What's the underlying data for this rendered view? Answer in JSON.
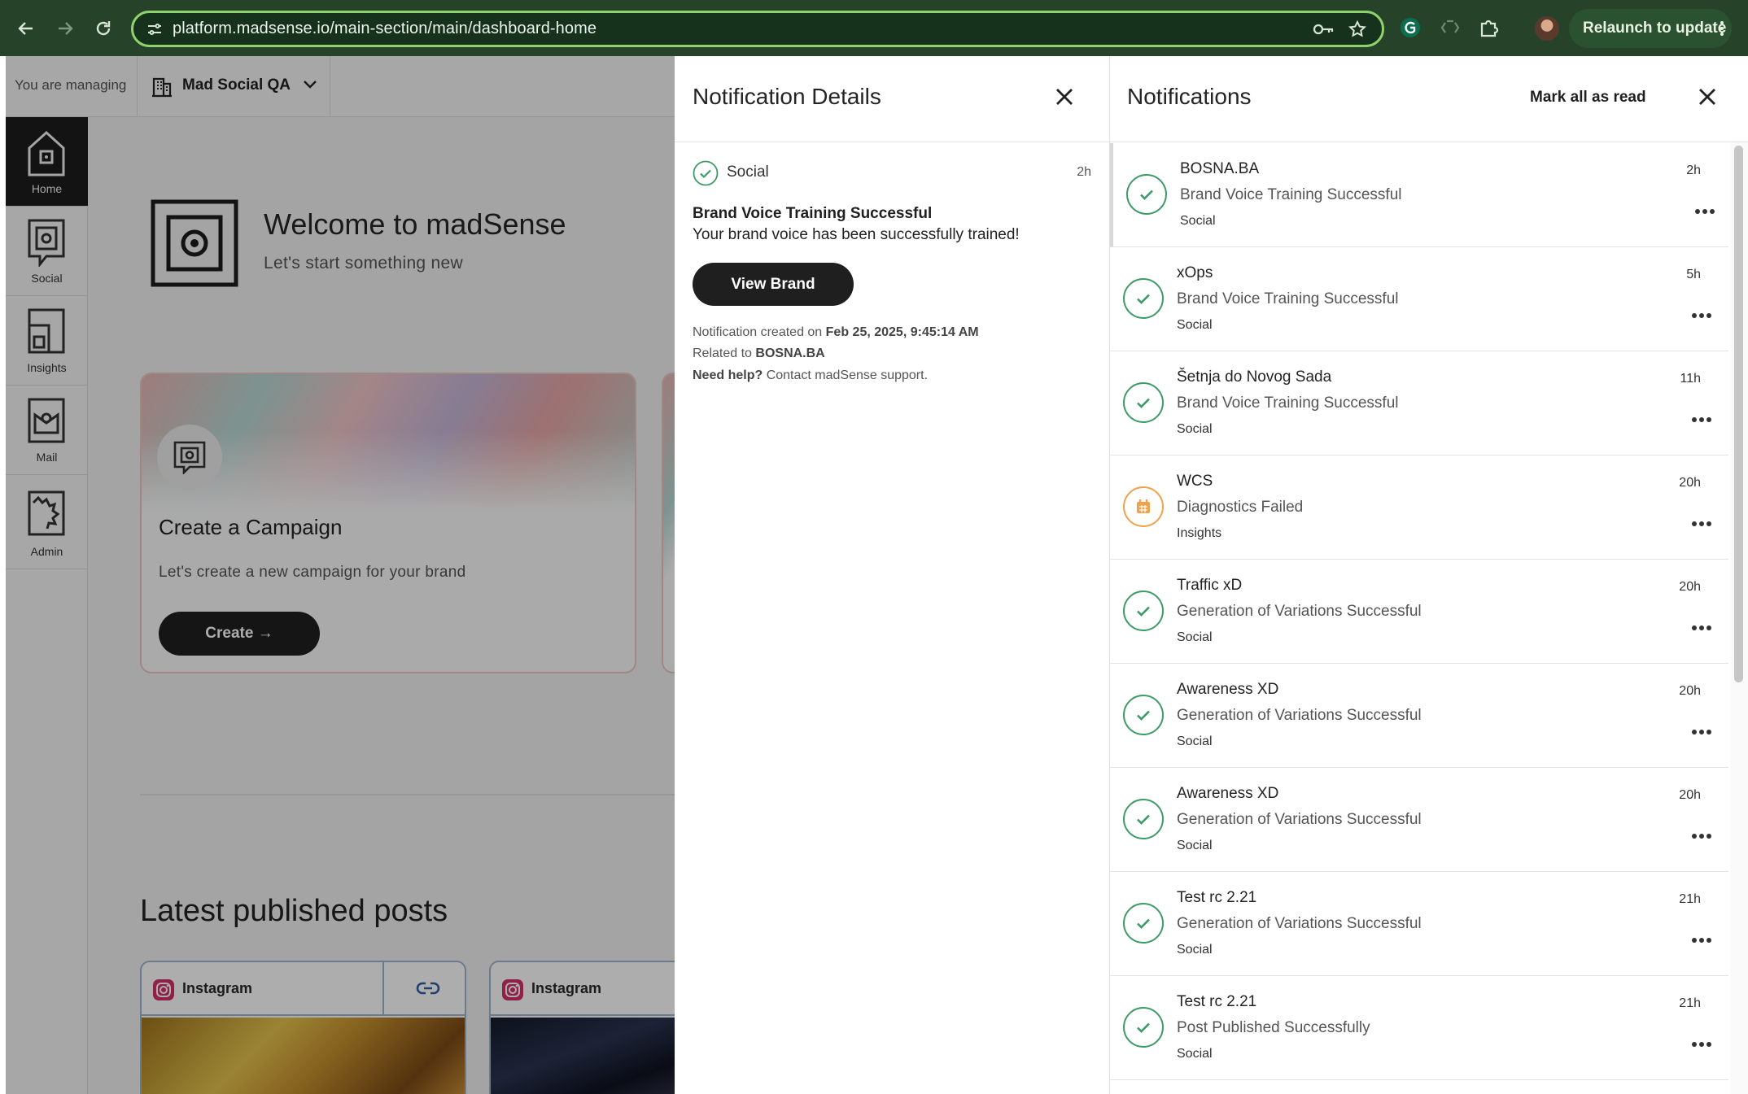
{
  "browser": {
    "url": "platform.madsense.io/main-section/main/dashboard-home",
    "relaunch_label": "Relaunch to update"
  },
  "topbar": {
    "managing_label": "You are managing",
    "org_name": "Mad Social QA"
  },
  "sidebar": {
    "items": [
      {
        "label": "Home",
        "icon": "home-icon",
        "active": true
      },
      {
        "label": "Social",
        "icon": "social-icon",
        "active": false
      },
      {
        "label": "Insights",
        "icon": "insights-icon",
        "active": false
      },
      {
        "label": "Mail",
        "icon": "mail-icon",
        "active": false
      },
      {
        "label": "Admin",
        "icon": "admin-icon",
        "active": false
      }
    ]
  },
  "home": {
    "welcome_title": "Welcome to madSense",
    "welcome_subtitle": "Let's start something new",
    "campaign_card": {
      "title": "Create a Campaign",
      "subtitle": "Let's create a new campaign for your brand",
      "button": "Create →"
    },
    "latest_title": "Latest published posts",
    "posts": [
      {
        "platform": "Instagram"
      },
      {
        "platform": "Instagram"
      }
    ]
  },
  "details": {
    "title": "Notification Details",
    "source": "Social",
    "time": "2h",
    "heading": "Brand Voice Training Successful",
    "body": "Your brand voice has been successfully trained!",
    "button": "View Brand",
    "created_prefix": "Notification created on",
    "created_value": "Feb 25, 2025, 9:45:14 AM",
    "related_prefix": "Related to",
    "related_value": "BOSNA.BA",
    "help_prefix": "Need help?",
    "help_suffix": "Contact madSense support."
  },
  "notifications": {
    "title": "Notifications",
    "mark_all": "Mark all as read",
    "items": [
      {
        "source": "BOSNA.BA",
        "message": "Brand Voice Training Successful",
        "module": "Social",
        "time": "2h",
        "status": "success"
      },
      {
        "source": "xOps",
        "message": "Brand Voice Training Successful",
        "module": "Social",
        "time": "5h",
        "status": "success"
      },
      {
        "source": "Šetnja do Novog Sada",
        "message": "Brand Voice Training Successful",
        "module": "Social",
        "time": "11h",
        "status": "success"
      },
      {
        "source": "WCS",
        "message": "Diagnostics Failed",
        "module": "Insights",
        "time": "20h",
        "status": "warning"
      },
      {
        "source": "Traffic xD",
        "message": "Generation of Variations Successful",
        "module": "Social",
        "time": "20h",
        "status": "success"
      },
      {
        "source": "Awareness XD",
        "message": "Generation of Variations Successful",
        "module": "Social",
        "time": "20h",
        "status": "success"
      },
      {
        "source": "Awareness XD",
        "message": "Generation of Variations Successful",
        "module": "Social",
        "time": "20h",
        "status": "success"
      },
      {
        "source": "Test rc 2.21",
        "message": "Generation of Variations Successful",
        "module": "Social",
        "time": "21h",
        "status": "success"
      },
      {
        "source": "Test rc 2.21",
        "message": "Post Published Successfully",
        "module": "Social",
        "time": "21h",
        "status": "success"
      }
    ]
  },
  "colors": {
    "chrome_bg": "#26432a",
    "success": "#3e9a67",
    "warning": "#f0a24b",
    "dark": "#1f1f1f"
  }
}
